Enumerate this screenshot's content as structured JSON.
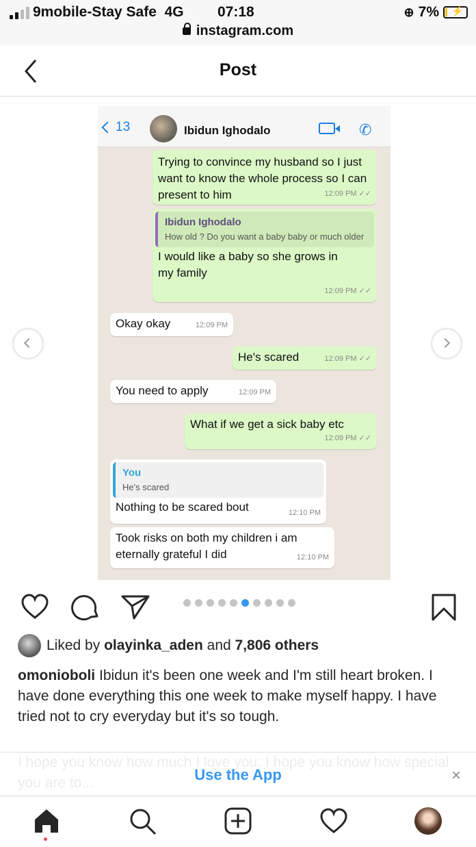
{
  "status_bar": {
    "carrier": "9mobile-Stay Safe",
    "network": "4G",
    "time": "07:18",
    "battery": "7%",
    "url": "instagram.com"
  },
  "nav": {
    "title": "Post"
  },
  "screenshot": {
    "contact_count": "13",
    "contact_name": "Ibidun Ighodalo",
    "messages": [
      {
        "text": "Trying to convince my husband so I just want to know the whole process so I can present to him",
        "time": "12:09 PM"
      },
      {
        "quote_name": "Ibidun Ighodalo",
        "quote_text": "How old ? Do you want a baby baby or much older",
        "text": "I would like a baby so she grows in my family",
        "time": "12:09 PM"
      },
      {
        "text": "Okay okay",
        "time": "12:09 PM"
      },
      {
        "text": "He's scared",
        "time": "12:09 PM"
      },
      {
        "text": "You need to apply",
        "time": "12:09 PM"
      },
      {
        "text": "What if we get a sick baby etc",
        "time": "12:09 PM"
      },
      {
        "quote_name": "You",
        "quote_text": "He's scared",
        "text": "Nothing to be scared bout",
        "time": "12:10 PM"
      },
      {
        "text": "Took risks on both my children i am eternally grateful I did",
        "time": "12:10 PM"
      }
    ]
  },
  "carousel": {
    "total": 10,
    "active": 5
  },
  "likes": {
    "prefix": "Liked by",
    "user": "olayinka_aden",
    "joiner": "and",
    "others": "7,806 others"
  },
  "caption": {
    "username": "omonioboli",
    "text": "Ibidun it's been one week and I'm still heart broken. I have done everything this one week to make myself happy. I have tried not to cry everyday but it's so tough.",
    "faded_text": "I hope you know how much I love you. I hope you know how special you are to..."
  },
  "banner": {
    "label": "Use the App",
    "close": "×"
  },
  "colors": {
    "accent": "#3897f0",
    "whatsapp_out": "#dcf8c6",
    "whatsapp_bg": "#ece5dd",
    "notify_dot": "#ed4956"
  },
  "icons": [
    "back-icon",
    "heart-icon",
    "comment-icon",
    "share-icon",
    "bookmark-icon",
    "home-icon",
    "search-icon",
    "add-icon",
    "activity-icon",
    "profile-avatar"
  ]
}
